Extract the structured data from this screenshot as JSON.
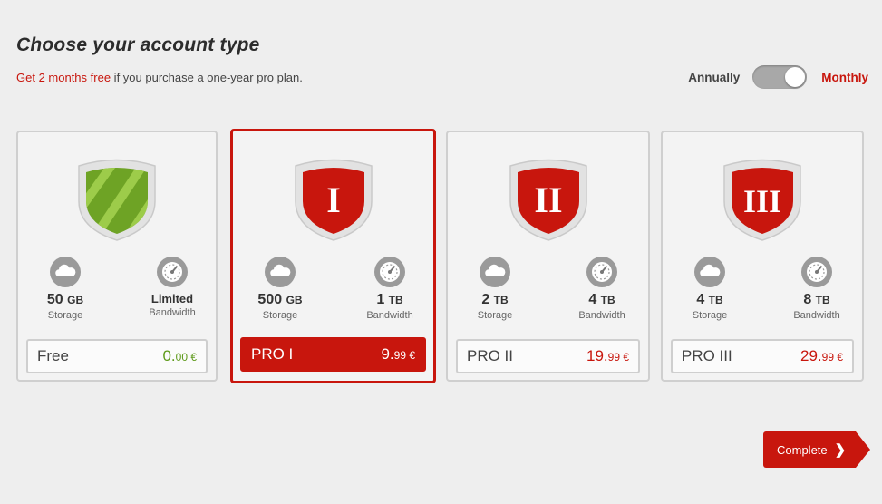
{
  "page": {
    "title": "Choose your account type",
    "promo_highlight": "Get 2 months free",
    "promo_rest": " if you purchase a one-year pro plan."
  },
  "billing": {
    "annual_label": "Annually",
    "monthly_label": "Monthly",
    "toggle_state": "monthly"
  },
  "plans": [
    {
      "shield_numeral": "",
      "shield_color": "#6ea325",
      "storage_value": "50",
      "storage_unit": "GB",
      "storage_label": "Storage",
      "bandwidth_value": "Limited",
      "bandwidth_unit": "",
      "bandwidth_label": "Bandwidth",
      "name": "Free",
      "price_main": "0.",
      "price_cents": "00 €",
      "selected": false
    },
    {
      "shield_numeral": "I",
      "shield_color": "#c8160d",
      "storage_value": "500",
      "storage_unit": "GB",
      "storage_label": "Storage",
      "bandwidth_value": "1",
      "bandwidth_unit": "TB",
      "bandwidth_label": "Bandwidth",
      "name": "PRO I",
      "price_main": "9.",
      "price_cents": "99 €",
      "selected": true
    },
    {
      "shield_numeral": "II",
      "shield_color": "#c8160d",
      "storage_value": "2",
      "storage_unit": "TB",
      "storage_label": "Storage",
      "bandwidth_value": "4",
      "bandwidth_unit": "TB",
      "bandwidth_label": "Bandwidth",
      "name": "PRO II",
      "price_main": "19.",
      "price_cents": "99 €",
      "selected": false
    },
    {
      "shield_numeral": "III",
      "shield_color": "#c8160d",
      "storage_value": "4",
      "storage_unit": "TB",
      "storage_label": "Storage",
      "bandwidth_value": "8",
      "bandwidth_unit": "TB",
      "bandwidth_label": "Bandwidth",
      "name": "PRO III",
      "price_main": "29.",
      "price_cents": "99 €",
      "selected": false
    }
  ],
  "actions": {
    "complete_label": "Complete"
  },
  "colors": {
    "accent": "#c8160d",
    "free_green": "#6ea325",
    "background": "#eeeeee"
  }
}
